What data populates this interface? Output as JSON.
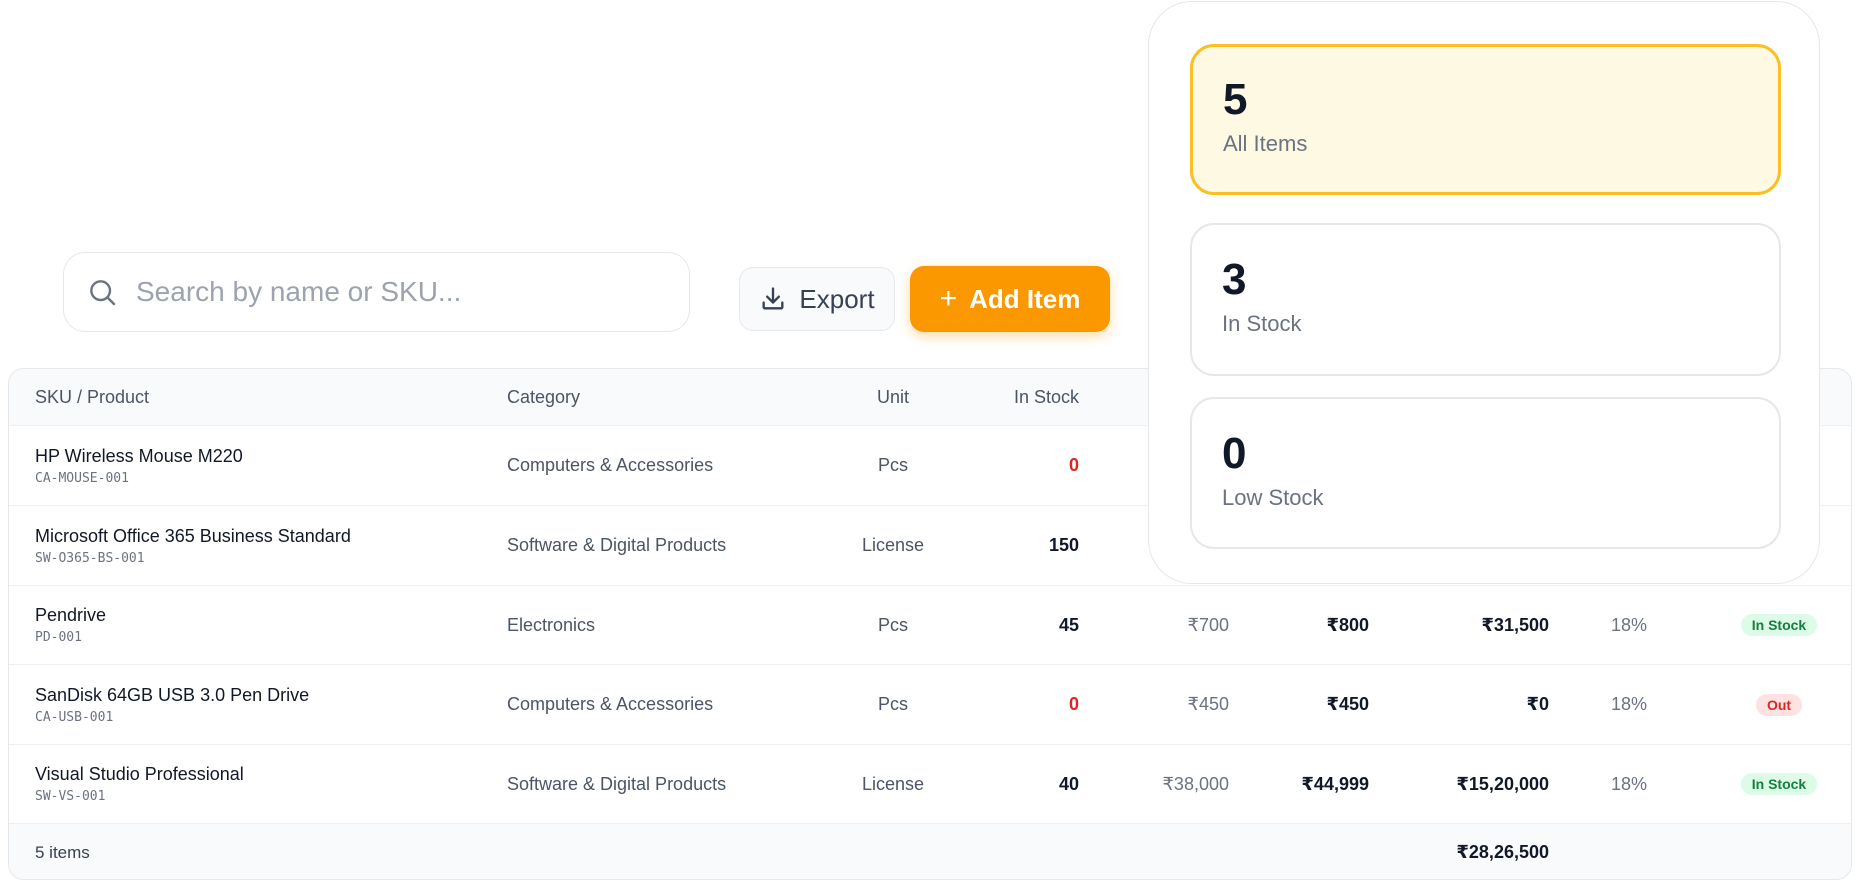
{
  "search": {
    "placeholder": "Search by name or SKU..."
  },
  "toolbar": {
    "export_label": "Export",
    "add_label": "Add Item"
  },
  "table": {
    "headers": {
      "product": "SKU / Product",
      "category": "Category",
      "unit": "Unit",
      "in_stock": "In Stock"
    },
    "rows": [
      {
        "name": "HP Wireless Mouse M220",
        "sku": "CA-MOUSE-001",
        "category": "Computers & Accessories",
        "unit": "Pcs",
        "stock": "0",
        "cost": "",
        "price": "",
        "value": "",
        "tax": "",
        "status": ""
      },
      {
        "name": "Microsoft Office 365 Business Standard",
        "sku": "SW-O365-BS-001",
        "category": "Software & Digital Products",
        "unit": "License",
        "stock": "150",
        "cost": "",
        "price": "",
        "value": "",
        "tax": "",
        "status": ""
      },
      {
        "name": "Pendrive",
        "sku": "PD-001",
        "category": "Electronics",
        "unit": "Pcs",
        "stock": "45",
        "cost": "₹700",
        "price": "₹800",
        "value": "₹31,500",
        "tax": "18%",
        "status": "In Stock"
      },
      {
        "name": "SanDisk 64GB USB 3.0 Pen Drive",
        "sku": "CA-USB-001",
        "category": "Computers & Accessories",
        "unit": "Pcs",
        "stock": "0",
        "cost": "₹450",
        "price": "₹450",
        "value": "₹0",
        "tax": "18%",
        "status": "Out"
      },
      {
        "name": "Visual Studio Professional",
        "sku": "SW-VS-001",
        "category": "Software & Digital Products",
        "unit": "License",
        "stock": "40",
        "cost": "₹38,000",
        "price": "₹44,999",
        "value": "₹15,20,000",
        "tax": "18%",
        "status": "In Stock"
      }
    ],
    "footer": {
      "count": "5 items",
      "total": "₹28,26,500"
    }
  },
  "stats": [
    {
      "value": "5",
      "label": "All Items",
      "active": true
    },
    {
      "value": "3",
      "label": "In Stock",
      "active": false
    },
    {
      "value": "0",
      "label": "Low Stock",
      "active": false
    }
  ],
  "colors": {
    "accent": "#fb9800",
    "danger": "#dc2626",
    "success": "#15803d"
  }
}
